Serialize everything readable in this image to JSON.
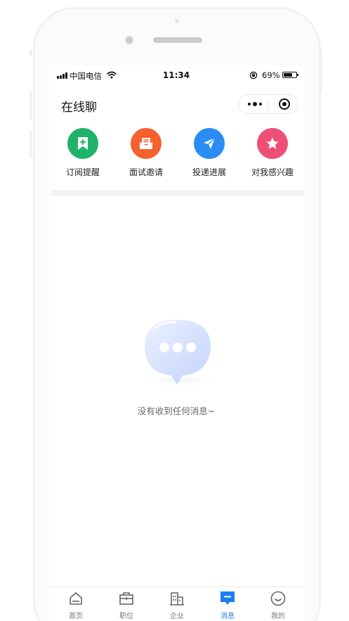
{
  "status_bar": {
    "carrier": "中国电信",
    "time": "11:34",
    "battery": "69%"
  },
  "header": {
    "title": "在线聊"
  },
  "quick_menu": [
    {
      "label": "订阅提醒",
      "icon": "bookmark-plus-icon",
      "color": "#1fb36a"
    },
    {
      "label": "面试邀请",
      "icon": "envelope-icon",
      "color": "#f5622d"
    },
    {
      "label": "投递进展",
      "icon": "paper-plane-icon",
      "color": "#2b8cf4"
    },
    {
      "label": "对我感兴趣",
      "icon": "star-icon",
      "color": "#ee4f78"
    }
  ],
  "empty_state": {
    "text": "没有收到任何消息~",
    "icon": "chat-bubble-icon"
  },
  "tabbar": {
    "active_color": "#1d7cf2",
    "tabs": [
      {
        "label": "首页",
        "icon": "home-icon"
      },
      {
        "label": "职位",
        "icon": "briefcase-icon"
      },
      {
        "label": "企业",
        "icon": "building-icon"
      },
      {
        "label": "消息",
        "icon": "message-icon",
        "active": true
      },
      {
        "label": "我的",
        "icon": "profile-icon"
      }
    ]
  }
}
